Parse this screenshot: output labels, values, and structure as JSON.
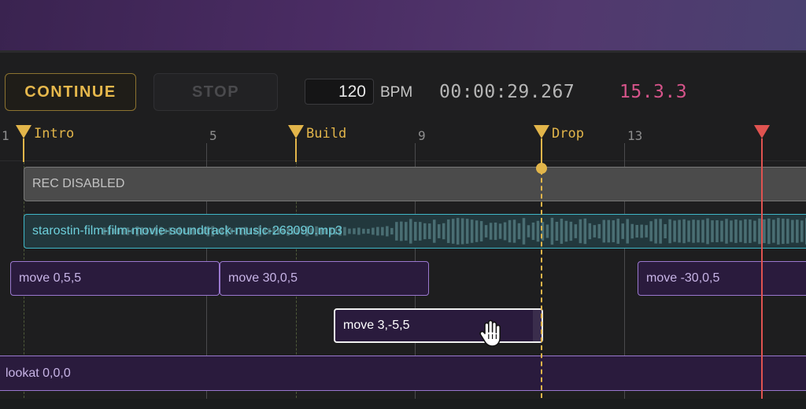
{
  "toolbar": {
    "continue_label": "CONTINUE",
    "stop_label": "STOP",
    "bpm_value": "120",
    "bpm_label": "BPM",
    "time": "00:00:29.267",
    "position": "15.3.3"
  },
  "ruler": {
    "bar_numbers": [
      "1",
      "5",
      "9",
      "13"
    ],
    "markers": [
      "Intro",
      "Build",
      "Drop"
    ]
  },
  "tracks": {
    "rec_label": "REC DISABLED",
    "audio_label": "starostin-film-film-movie-soundtrack-music-263090.mp3",
    "move_clips": [
      "move  0,5,5",
      "move  30,0,5",
      "move  -30,0,5",
      "move  3,-5,5"
    ],
    "lookat_label": "lookat 0,0,0"
  },
  "colors": {
    "accent": "#e2b54a",
    "playhead": "#e05350",
    "position": "#d6548a",
    "audio": "#3fb7c8",
    "clip": "#9a78cf"
  },
  "icons": {
    "cursor": "hand-grab-icon"
  }
}
